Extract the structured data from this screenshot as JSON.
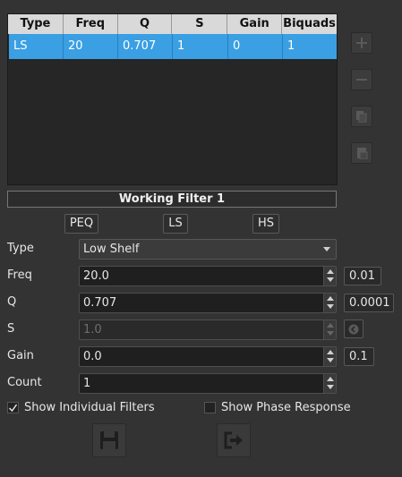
{
  "table": {
    "columns": [
      "Type",
      "Freq",
      "Q",
      "S",
      "Gain",
      "Biquads"
    ],
    "rows": [
      [
        "LS",
        "20",
        "0.707",
        "1",
        "0",
        "1"
      ]
    ]
  },
  "side_buttons": [
    "add-icon",
    "remove-icon",
    "copy-icon",
    "paste-icon"
  ],
  "working_filter_title": "Working Filter 1",
  "filter_type_buttons": {
    "peq": "PEQ",
    "ls": "LS",
    "hs": "HS"
  },
  "fields": {
    "type": {
      "label": "Type",
      "value": "Low Shelf"
    },
    "freq": {
      "label": "Freq",
      "value": "20.0",
      "step": "0.01"
    },
    "q": {
      "label": "Q",
      "value": "0.707",
      "step": "0.0001"
    },
    "s": {
      "label": "S",
      "value": "1.0",
      "disabled": true
    },
    "gain": {
      "label": "Gain",
      "value": "0.0",
      "step": "0.1"
    },
    "count": {
      "label": "Count",
      "value": "1"
    }
  },
  "options": {
    "show_individual_filters": {
      "label": "Show Individual Filters",
      "checked": true
    },
    "show_phase_response": {
      "label": "Show Phase Response",
      "checked": false
    }
  },
  "bottom_buttons": [
    "save-icon",
    "export-icon"
  ],
  "colors": {
    "selection": "#3a9fe3",
    "background": "#333333",
    "header": "#d9d9d9"
  }
}
